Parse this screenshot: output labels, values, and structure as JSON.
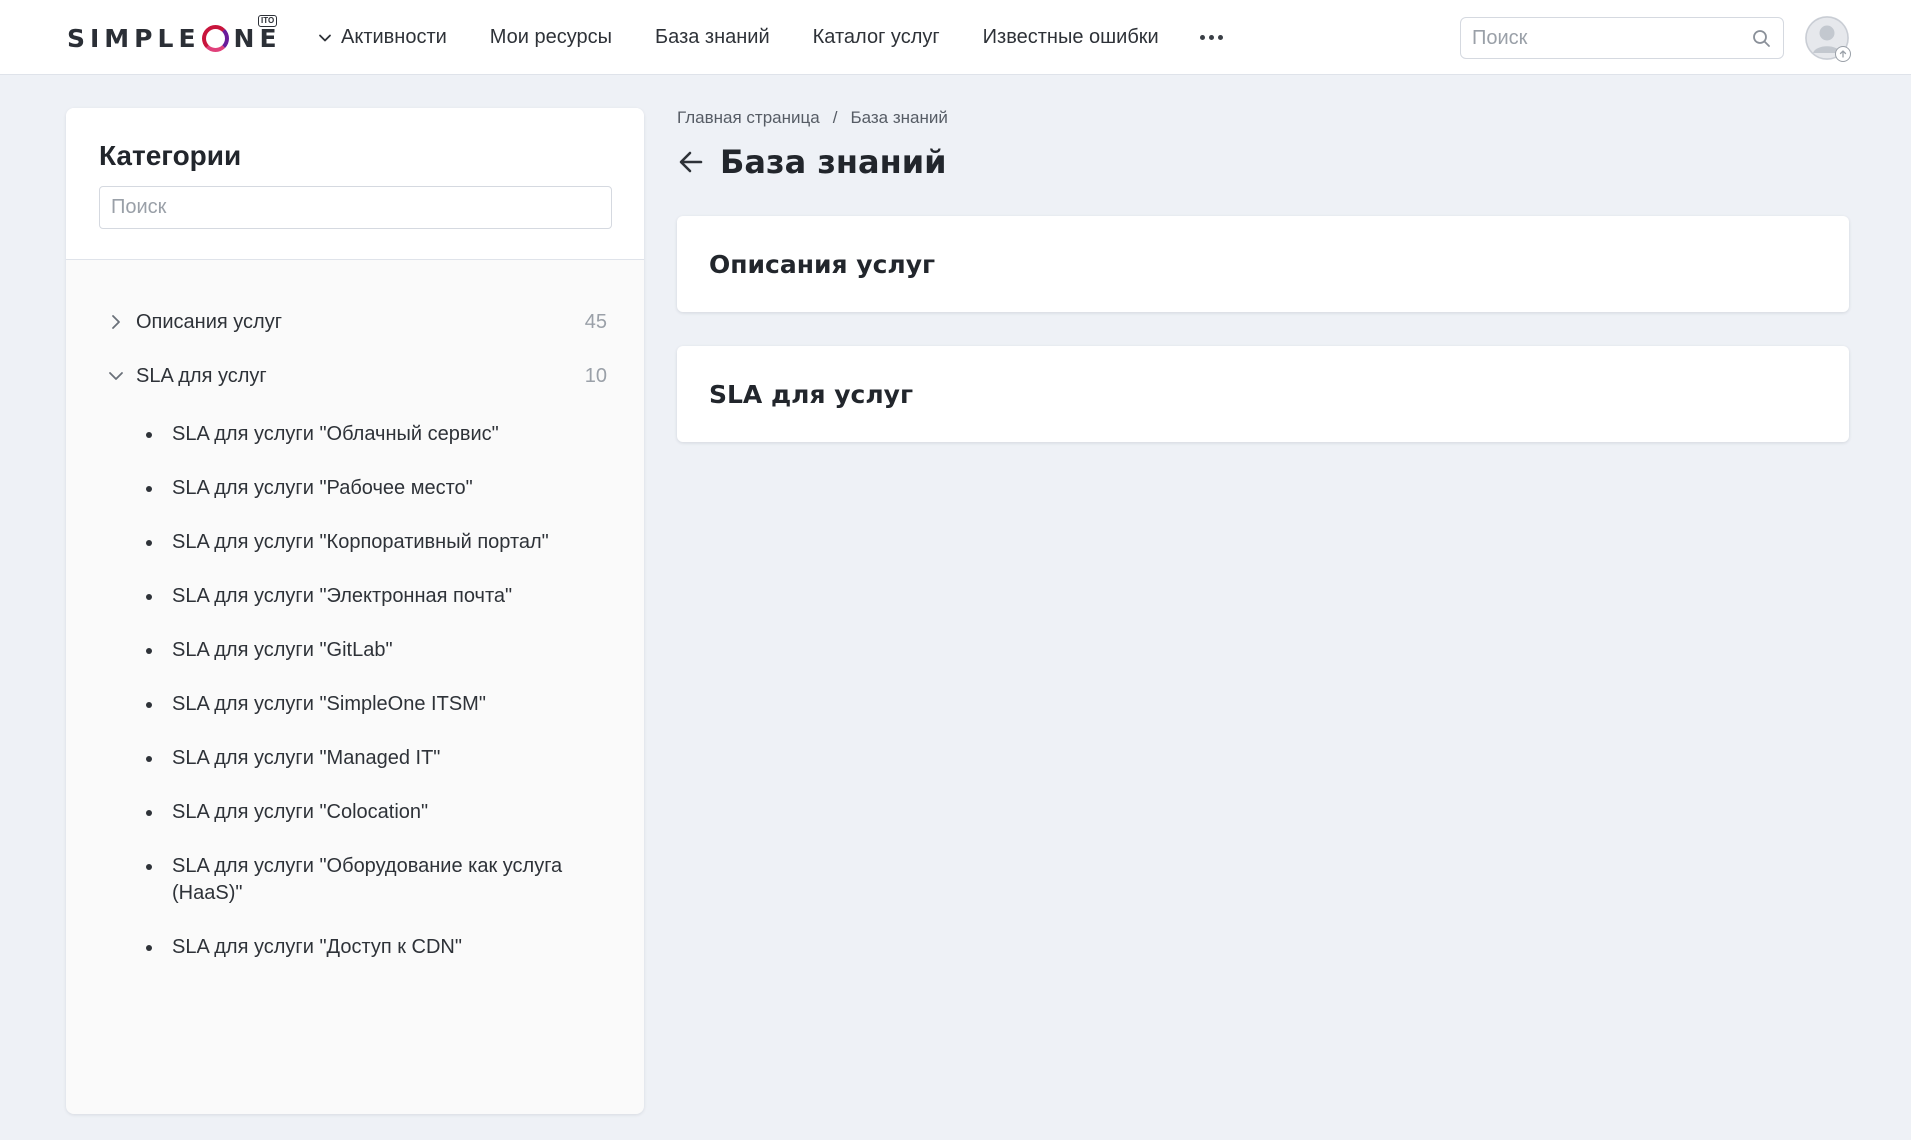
{
  "header": {
    "logo_left": "SIMPL",
    "logo_mid": "E",
    "logo_right": "NE",
    "logo_badge": "ITO",
    "nav": [
      {
        "label": "Активности",
        "dropdown": true
      },
      {
        "label": "Мои ресурсы"
      },
      {
        "label": "База знаний"
      },
      {
        "label": "Каталог услуг"
      },
      {
        "label": "Известные ошибки"
      }
    ],
    "search_placeholder": "Поиск",
    "icons": {
      "search": "search-icon",
      "more": "more-horizontal-icon",
      "avatar": "user-avatar-icon"
    }
  },
  "sidebar": {
    "title": "Категории",
    "search_placeholder": "Поиск",
    "categories": [
      {
        "label": "Описания услуг",
        "count": "45",
        "expanded": false
      },
      {
        "label": "SLA для услуг",
        "count": "10",
        "expanded": true
      }
    ],
    "sla_items": [
      "SLA для услуги \"Облачный сервис\"",
      "SLA для услуги \"Рабочее место\"",
      "SLA для услуги \"Корпоративный портал\"",
      "SLA для услуги \"Электронная почта\"",
      "SLA для услуги \"GitLab\"",
      "SLA для услуги \"SimpleOne ITSM\"",
      "SLA для услуги \"Managed IT\"",
      "SLA для услуги \"Colocation\"",
      "SLA для услуги \"Оборудование как услуга (HaaS)\"",
      "SLA для услуги \"Доступ к CDN\""
    ]
  },
  "main": {
    "breadcrumb": [
      "Главная страница",
      "База знаний"
    ],
    "breadcrumb_sep": "/",
    "title": "База знаний",
    "cards": [
      "Описания услуг",
      "SLA для услуг"
    ]
  },
  "colors": {
    "accent": "#c8143c",
    "background": "#eef1f6",
    "text": "#2e3238"
  }
}
